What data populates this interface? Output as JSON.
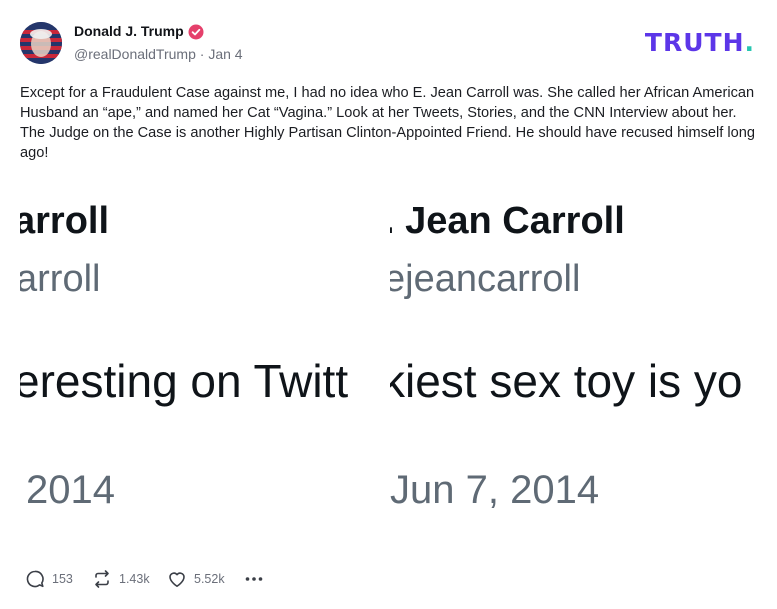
{
  "post": {
    "author_name": "Donald J. Trump",
    "handle": "@realDonaldTrump",
    "separator": "·",
    "date": "Jan 4",
    "logo_text": "TRUTH",
    "logo_dot": ".",
    "text": "Except for a Fraudulent Case against me, I had no idea who E. Jean Carroll was. She called her African American Husband an “ape,” and named her Cat “Vagina.” Look at her Tweets, Stories, and the CNN Interview about her. The Judge on the Case is another Highly Partisan Clinton-Appointed Friend. He should have recused himself long ago!",
    "media": {
      "left": {
        "name_fragment": "arroll",
        "handle_fragment": "arroll",
        "tweet_fragment": "eresting on Twitt",
        "date_fragment": "2014"
      },
      "right": {
        "name_fragment": ". Jean Carroll",
        "handle_fragment": "ejeancarroll",
        "tweet_fragment": "kiest sex toy is yo",
        "date_fragment": "Jun 7, 2014"
      }
    },
    "actions": {
      "replies": "153",
      "retruths": "1.43k",
      "likes": "5.52k"
    }
  },
  "colors": {
    "logo": "#5c36e8",
    "logo_dot": "#26c6b0",
    "verified": "#e5406b",
    "muted": "#6b6f7a"
  },
  "icons": [
    "avatar-image",
    "verified-badge-icon",
    "reply-icon",
    "retruth-icon",
    "like-icon",
    "more-icon"
  ]
}
